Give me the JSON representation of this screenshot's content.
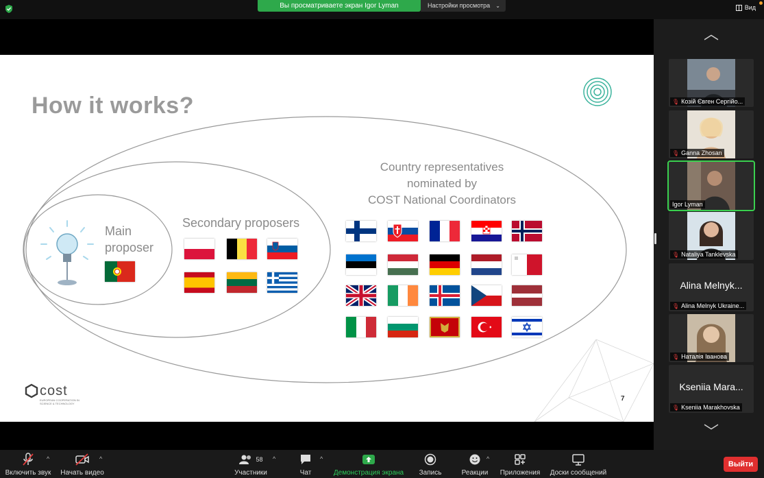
{
  "topbar": {
    "share_banner": "Вы просматриваете экран Igor Lyman",
    "view_settings": "Настройки просмотра",
    "view_button": "Вид"
  },
  "slide": {
    "title": "How it works?",
    "main_proposer_line1": "Main",
    "main_proposer_line2": "proposer",
    "secondary_proposers": "Secondary proposers",
    "country_reps_line1": "Country representatives",
    "country_reps_line2": "nominated by",
    "country_reps_line3": "COST National Coordinators",
    "logo_text": "cost",
    "logo_subtext": "EUROPEAN COOPERATION IN SCIENCE & TECHNOLOGY",
    "page_number": "7",
    "flags": {
      "main": [
        "portugal"
      ],
      "secondary": [
        "poland",
        "belgium",
        "slovenia",
        "spain",
        "lithuania",
        "greece"
      ],
      "country": [
        "finland",
        "slovakia",
        "france",
        "croatia",
        "norway",
        "estonia",
        "hungary",
        "germany",
        "netherlands",
        "malta",
        "uk",
        "ireland",
        "iceland",
        "czechia",
        "latvia",
        "italy",
        "bulgaria",
        "montenegro",
        "turkey",
        "israel"
      ]
    }
  },
  "participants": [
    {
      "name": "Козій Євген Сергійо...",
      "big": "",
      "muted": true,
      "active": false
    },
    {
      "name": "Ganna Zhosan",
      "big": "",
      "muted": true,
      "active": false
    },
    {
      "name": "Igor Lyman",
      "big": "",
      "muted": false,
      "active": true
    },
    {
      "name": "Nataliya Tanklevska",
      "big": "",
      "muted": true,
      "active": false
    },
    {
      "name": "Alina Melnyk Ukraine...",
      "big": "Alina Melnyk...",
      "muted": true,
      "active": false
    },
    {
      "name": "Наталія Іванова",
      "big": "",
      "muted": true,
      "active": false
    },
    {
      "name": "Kseniia Marakhovska",
      "big": "Kseniia Mara...",
      "muted": true,
      "active": false
    }
  ],
  "toolbar": {
    "unmute": "Включить звук",
    "start_video": "Начать видео",
    "participants": "Участники",
    "participants_count": "58",
    "chat": "Чат",
    "share_screen": "Демонстрация экрана",
    "record": "Запись",
    "reactions": "Реакции",
    "apps": "Приложения",
    "whiteboards": "Доски сообщений",
    "leave": "Выйти"
  },
  "colors": {
    "share_green": "#2ea94b",
    "leave_red": "#e02f2f",
    "active_outline": "#3ad04f"
  }
}
